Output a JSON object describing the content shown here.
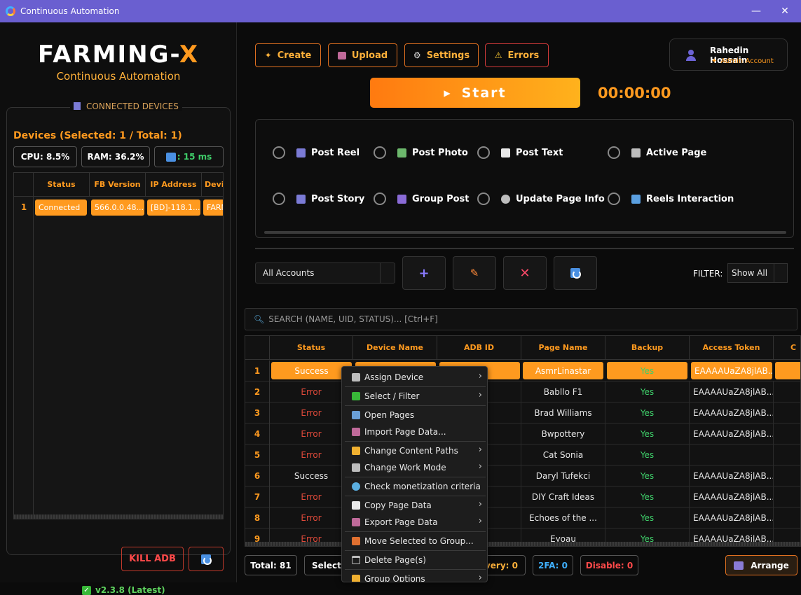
{
  "window": {
    "title": "Continuous Automation",
    "minimize": "—",
    "maximize": "☐",
    "close": "✕"
  },
  "brand": {
    "logo_main": "FARMING-",
    "logo_accent": "X",
    "subtitle": "Continuous Automation"
  },
  "devices": {
    "section_title": "CONNECTED DEVICES",
    "count_label": "Devices (Selected: 1 / Total: 1)",
    "cpu": "CPU: 8.5%",
    "ram": "RAM: 36.2%",
    "ping": ": 15 ms",
    "columns": [
      "Status",
      "FB Version",
      "IP Address",
      "Devic"
    ],
    "rows": [
      {
        "num": "1",
        "status": "Connected",
        "fb_version": "566.0.0.48....",
        "ip": "[BD]-118.1...",
        "device": "FARM"
      }
    ],
    "kill_label": "KILL ADB",
    "version": "v2.3.8 (Latest)"
  },
  "toolbar": {
    "create": "Create",
    "upload": "Upload",
    "settings": "Settings",
    "errors": "Errors"
  },
  "user": {
    "name": "Rahedin Hossain",
    "role": "Admin Account"
  },
  "start_label": "Start",
  "timer": "00:00:00",
  "tasks": [
    {
      "label": "Post Reel",
      "icon": "clapper-icon",
      "color": "#7b7bd6"
    },
    {
      "label": "Post Photo",
      "icon": "photo-icon",
      "color": "#6cb86c"
    },
    {
      "label": "Post Text",
      "icon": "document-icon",
      "color": "#e8e8e8"
    },
    {
      "label": "Active Page",
      "icon": "link-icon",
      "color": "#bdbdbd"
    },
    {
      "label": "Post Story",
      "icon": "film-icon",
      "color": "#7b7bd6"
    },
    {
      "label": "Group Post",
      "icon": "people-icon",
      "color": "#8a6bd6"
    },
    {
      "label": "Update Page Info",
      "icon": "gear-icon",
      "color": "#bdbdbd"
    },
    {
      "label": "Reels Interaction",
      "icon": "film-strip-icon",
      "color": "#5a9fe0"
    }
  ],
  "accounts": {
    "selected": "All Accounts",
    "filter_label": "FILTER:",
    "filter_value": "Show All"
  },
  "search": {
    "placeholder": "SEARCH (NAME, UID, STATUS)... [Ctrl+F]"
  },
  "table": {
    "columns": [
      "Status",
      "Device Name",
      "ADB ID",
      "Page Name",
      "Backup",
      "Access Token",
      "C"
    ],
    "rows": [
      {
        "num": "1",
        "status": "Success",
        "page": "AsmrLinastar",
        "backup": "Yes",
        "token": "EAAAAUaZA8jlAB..."
      },
      {
        "num": "2",
        "status": "Error",
        "page": "Babllo F1",
        "backup": "Yes",
        "token": "EAAAAUaZA8jlAB..."
      },
      {
        "num": "3",
        "status": "Error",
        "page": "Brad Williams",
        "backup": "Yes",
        "token": "EAAAAUaZA8jlAB..."
      },
      {
        "num": "4",
        "status": "Error",
        "page": "Bwpottery",
        "backup": "Yes",
        "token": "EAAAAUaZA8jlAB..."
      },
      {
        "num": "5",
        "status": "Error",
        "page": "Cat Sonia",
        "backup": "Yes",
        "token": ""
      },
      {
        "num": "6",
        "status": "Success",
        "page": "Daryl Tufekci",
        "backup": "Yes",
        "token": "EAAAAUaZA8jlAB..."
      },
      {
        "num": "7",
        "status": "Error",
        "page": "DIY Craft Ideas",
        "backup": "Yes",
        "token": "EAAAAUaZA8jlAB..."
      },
      {
        "num": "8",
        "status": "Error",
        "page": "Echoes of the ...",
        "backup": "Yes",
        "token": "EAAAAUaZA8jlAB..."
      },
      {
        "num": "9",
        "status": "Error",
        "page": "Eyoau",
        "backup": "Yes",
        "token": "EAAAAUaZA8jlAB..."
      }
    ]
  },
  "context_menu": [
    {
      "label": "Assign Device",
      "submenu": true,
      "icon": "link-icon",
      "color": "#bdbdbd"
    },
    {
      "label": "Select / Filter",
      "submenu": true,
      "icon": "checkbox-icon",
      "color": "#38b838"
    },
    {
      "label": "Open Pages",
      "submenu": false,
      "icon": "book-icon",
      "color": "#6a9fd6"
    },
    {
      "label": "Import Page Data...",
      "submenu": false,
      "icon": "inbox-icon",
      "color": "#c06a9a"
    },
    {
      "label": "Change Content Paths",
      "submenu": true,
      "icon": "folder-icon",
      "color": "#f0b030"
    },
    {
      "label": "Change Work Mode",
      "submenu": true,
      "icon": "tools-icon",
      "color": "#bdbdbd"
    },
    {
      "label": "Check monetization criteria",
      "submenu": false,
      "icon": "magnifier-icon",
      "color": "#5aaee0"
    },
    {
      "label": "Copy Page Data",
      "submenu": true,
      "icon": "copy-icon",
      "color": "#e8e8e8"
    },
    {
      "label": "Export Page Data",
      "submenu": true,
      "icon": "outbox-icon",
      "color": "#c06a9a"
    },
    {
      "label": "Move Selected to Group...",
      "submenu": false,
      "icon": "truck-icon",
      "color": "#e07030"
    },
    {
      "label": "Delete Page(s)",
      "submenu": false,
      "icon": "trash-icon",
      "color": "#bdbdbd"
    },
    {
      "label": "Group Options",
      "submenu": true,
      "icon": "folder-icon",
      "color": "#f0b030"
    }
  ],
  "footer": {
    "total": "Total: 81",
    "selected": "Selecte",
    "recovery": "very: 0",
    "twofa": "2FA: 0",
    "disable": "Disable: 0",
    "arrange": "Arrange"
  }
}
